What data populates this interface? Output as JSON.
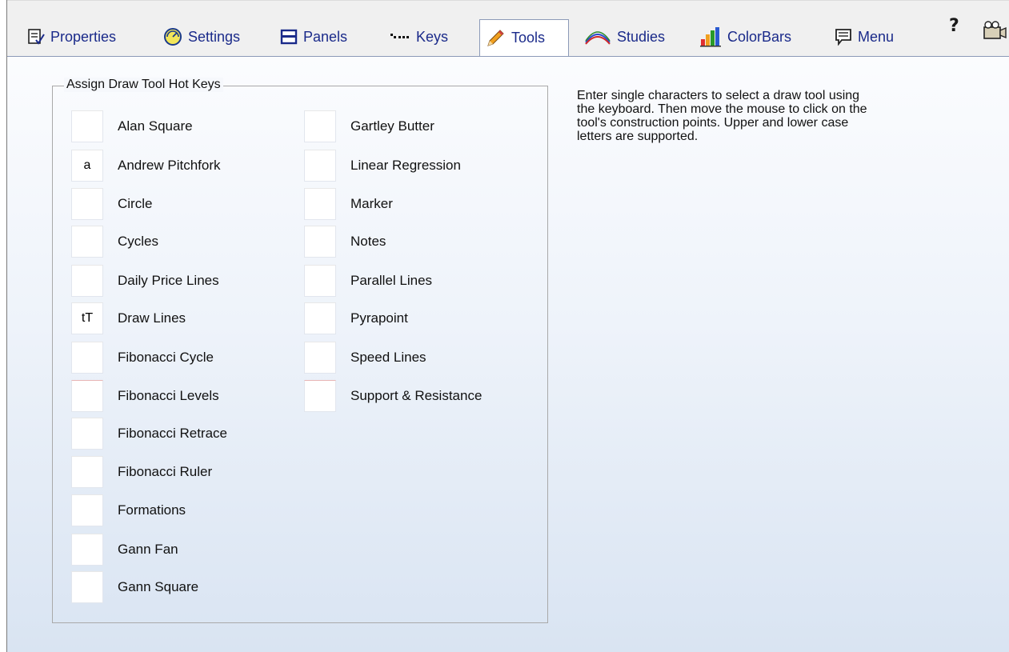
{
  "tabs": [
    {
      "label": "Properties",
      "icon": "properties-icon",
      "active": false
    },
    {
      "label": "Settings",
      "icon": "settings-icon",
      "active": false
    },
    {
      "label": "Panels",
      "icon": "panels-icon",
      "active": false
    },
    {
      "label": "Keys",
      "icon": "keys-icon",
      "active": false
    },
    {
      "label": "Tools",
      "icon": "pencil-icon",
      "active": true
    },
    {
      "label": "Studies",
      "icon": "studies-icon",
      "active": false
    },
    {
      "label": "ColorBars",
      "icon": "colorbars-icon",
      "active": false
    },
    {
      "label": "Menu",
      "icon": "menu-icon",
      "active": false
    }
  ],
  "toolbar": {
    "help_label": "?",
    "camera_icon": "camera-icon"
  },
  "group": {
    "title": "Assign Draw Tool Hot Keys",
    "left_column": [
      {
        "label": "Alan Square",
        "key": ""
      },
      {
        "label": "Andrew Pitchfork",
        "key": "a"
      },
      {
        "label": "Circle",
        "key": ""
      },
      {
        "label": "Cycles",
        "key": ""
      },
      {
        "label": "Daily Price Lines",
        "key": ""
      },
      {
        "label": "Draw Lines",
        "key": "tT"
      },
      {
        "label": "Fibonacci Cycle",
        "key": ""
      },
      {
        "label": "Fibonacci Levels",
        "key": ""
      },
      {
        "label": "Fibonacci Retrace",
        "key": ""
      },
      {
        "label": "Fibonacci Ruler",
        "key": ""
      },
      {
        "label": "Formations",
        "key": ""
      },
      {
        "label": "Gann Fan",
        "key": ""
      },
      {
        "label": "Gann Square",
        "key": ""
      }
    ],
    "right_column": [
      {
        "label": "Gartley Butter",
        "key": ""
      },
      {
        "label": "Linear Regression",
        "key": ""
      },
      {
        "label": "Marker",
        "key": ""
      },
      {
        "label": "Notes",
        "key": ""
      },
      {
        "label": "Parallel Lines",
        "key": ""
      },
      {
        "label": "Pyrapoint",
        "key": ""
      },
      {
        "label": "Speed Lines",
        "key": ""
      },
      {
        "label": "Support & Resistance",
        "key": ""
      }
    ]
  },
  "help": {
    "lines": [
      "Enter single characters to select a draw tool using",
      "the keyboard.  Then move the mouse to click on the",
      "tool's construction points.   Upper and lower case",
      "letters are supported."
    ]
  },
  "colors": {
    "tab_text": "#1a2a8a",
    "panel_top": "#fbfcfe",
    "panel_bottom": "#d9e4f2",
    "active_tab_border": "#8c9ab8"
  }
}
